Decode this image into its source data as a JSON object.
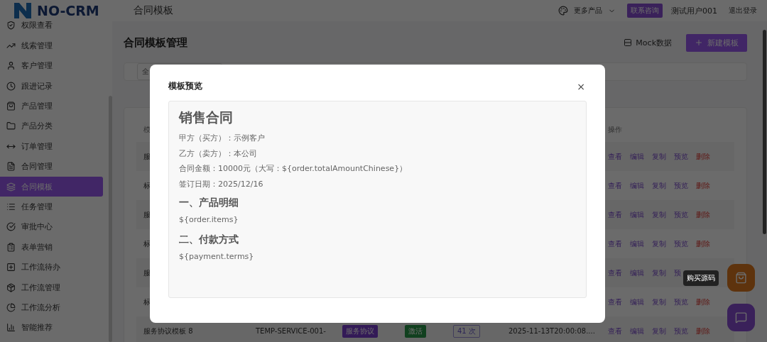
{
  "header": {
    "logo_text": "NO-CRM",
    "page_title": "合同模板",
    "more_products": "更多产品",
    "contact_badge": "联系咨询",
    "username": "测试用户001",
    "logout": "退出登录"
  },
  "sidebar": {
    "items": [
      {
        "label": "权限查看",
        "selected": false
      },
      {
        "label": "线索管理",
        "selected": false
      },
      {
        "label": "客户管理",
        "selected": false
      },
      {
        "label": "跟进记录",
        "selected": false
      },
      {
        "label": "产品管理",
        "selected": false
      },
      {
        "label": "产品分类",
        "selected": false
      },
      {
        "label": "订单管理",
        "selected": false
      },
      {
        "label": "合同管理",
        "selected": false
      },
      {
        "label": "合同模板",
        "selected": true
      },
      {
        "label": "任务管理",
        "selected": false
      },
      {
        "label": "审批中心",
        "selected": false
      },
      {
        "label": "表单营销",
        "selected": false
      },
      {
        "label": "工作流待办",
        "selected": false
      },
      {
        "label": "工作流管理",
        "selected": false
      },
      {
        "label": "工作流分析",
        "selected": false
      },
      {
        "label": "智能推荐",
        "selected": false
      }
    ]
  },
  "content": {
    "title": "合同模板管理",
    "mock_button": "Mock数据",
    "new_button": "新建模板",
    "filter_field": "全",
    "table": {
      "columns": [
        "模",
        "操作"
      ],
      "rows": [
        {
          "name": "服",
          "actions": [
            {
              "label": "查看",
              "danger": false
            },
            {
              "label": "编辑",
              "danger": false
            },
            {
              "label": "复制",
              "danger": false
            },
            {
              "label": "预览",
              "danger": false
            },
            {
              "label": "删除",
              "danger": true
            }
          ]
        },
        {
          "name": "标",
          "actions": [
            {
              "label": "查看",
              "danger": false
            },
            {
              "label": "编辑",
              "danger": false
            },
            {
              "label": "复制",
              "danger": false
            },
            {
              "label": "预览",
              "danger": false
            },
            {
              "label": "删除",
              "danger": true
            }
          ]
        },
        {
          "name": "服",
          "actions": [
            {
              "label": "查看",
              "danger": false
            },
            {
              "label": "编辑",
              "danger": false
            },
            {
              "label": "复制",
              "danger": false
            },
            {
              "label": "预览",
              "danger": false
            },
            {
              "label": "删除",
              "danger": true
            }
          ]
        },
        {
          "name": "标",
          "actions": [
            {
              "label": "查看",
              "danger": false
            },
            {
              "label": "编辑",
              "danger": false
            },
            {
              "label": "复制",
              "danger": false
            },
            {
              "label": "预览",
              "danger": false
            },
            {
              "label": "删除",
              "danger": true
            }
          ]
        },
        {
          "name": "服",
          "actions": [
            {
              "label": "查看",
              "danger": false
            },
            {
              "label": "编辑",
              "danger": false
            },
            {
              "label": "复制",
              "danger": false
            },
            {
              "label": "预",
              "danger": false
            }
          ]
        },
        {
          "name": "标",
          "actions": [
            {
              "label": "查看",
              "danger": false
            },
            {
              "label": "编辑",
              "danger": false
            },
            {
              "label": "复制",
              "danger": false
            },
            {
              "label": "预览",
              "danger": false
            },
            {
              "label": "删除",
              "danger": true
            }
          ]
        },
        {
          "name": "服务协议模板 8",
          "code": "TEMP-SERVICE-001-",
          "type_tag": "服务协议",
          "status_tag": "激活",
          "usage": "41 次",
          "date": "2025-11-13T20:00:08....",
          "actions": [
            {
              "label": "查看",
              "danger": false
            },
            {
              "label": "编辑",
              "danger": false
            },
            {
              "label": "复制",
              "danger": false
            },
            {
              "label": "预览",
              "danger": false
            },
            {
              "label": "删除",
              "danger": true
            }
          ]
        }
      ]
    }
  },
  "tooltip": "购买源码",
  "modal": {
    "title": "模板预览",
    "close": "×",
    "blocks": [
      {
        "kind": "title",
        "text": "销售合同"
      },
      {
        "kind": "line",
        "text": "甲方（买方）：示例客户"
      },
      {
        "kind": "line",
        "text": "乙方（卖方）：本公司"
      },
      {
        "kind": "line",
        "text": "合同金额：10000元（大写：${order.totalAmountChinese}）"
      },
      {
        "kind": "line",
        "text": "签订日期：2025/12/16"
      },
      {
        "kind": "heading",
        "text": "一、产品明细"
      },
      {
        "kind": "line",
        "text": "${order.items}"
      },
      {
        "kind": "heading",
        "text": "二、付款方式"
      },
      {
        "kind": "line",
        "text": "${payment.terms}"
      }
    ]
  }
}
